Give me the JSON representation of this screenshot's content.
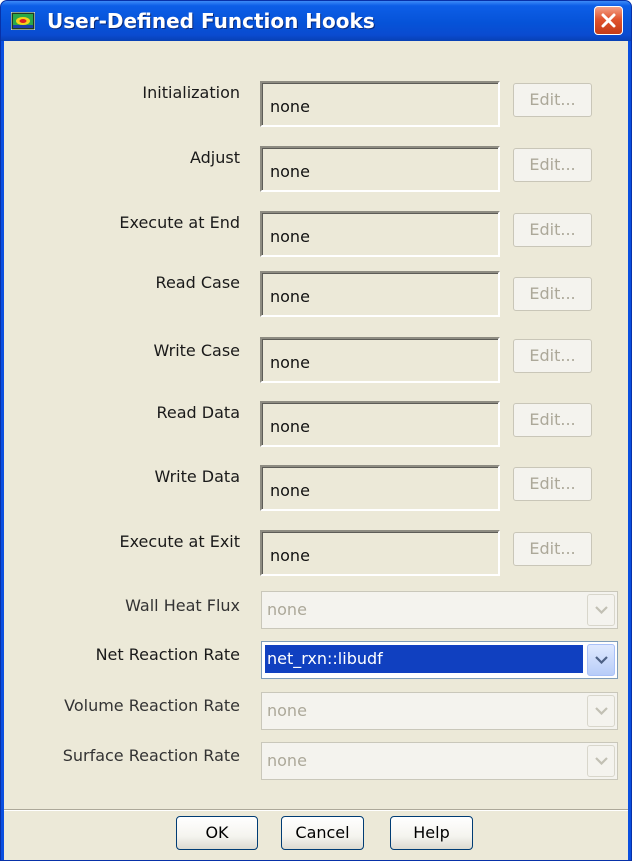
{
  "window": {
    "title": "User-Defined Function Hooks",
    "titlebar_color": "#0a4fe0",
    "client_color": "#ece9d8"
  },
  "hooks": [
    {
      "label": "Initialization",
      "value": "none",
      "edit_label": "Edit..."
    },
    {
      "label": "Adjust",
      "value": "none",
      "edit_label": "Edit..."
    },
    {
      "label": "Execute at End",
      "value": "none",
      "edit_label": "Edit..."
    },
    {
      "label": "Read Case",
      "value": "none",
      "edit_label": "Edit..."
    },
    {
      "label": "Write Case",
      "value": "none",
      "edit_label": "Edit..."
    },
    {
      "label": "Read Data",
      "value": "none",
      "edit_label": "Edit..."
    },
    {
      "label": "Write Data",
      "value": "none",
      "edit_label": "Edit..."
    },
    {
      "label": "Execute at Exit",
      "value": "none",
      "edit_label": "Edit..."
    }
  ],
  "selectors": [
    {
      "label": "Wall Heat Flux",
      "value": "none",
      "enabled": false
    },
    {
      "label": "Net Reaction Rate",
      "value": "net_rxn::libudf",
      "enabled": true
    },
    {
      "label": "Volume Reaction Rate",
      "value": "none",
      "enabled": false
    },
    {
      "label": "Surface Reaction Rate",
      "value": "none",
      "enabled": false
    }
  ],
  "buttons": {
    "ok": "OK",
    "cancel": "Cancel",
    "help": "Help"
  },
  "icons": {
    "app": "fluent-app-icon",
    "close": "close-icon",
    "dropdown": "chevron-down-icon"
  }
}
